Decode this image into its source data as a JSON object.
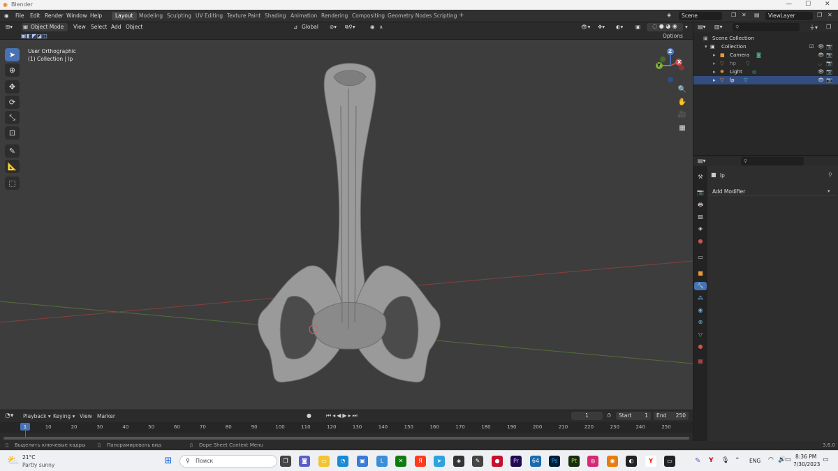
{
  "window": {
    "title": "Blender",
    "minimize": "—",
    "maximize": "☐",
    "close": "✕"
  },
  "menu": [
    "File",
    "Edit",
    "Render",
    "Window",
    "Help"
  ],
  "workspaces": [
    "Layout",
    "Modeling",
    "Sculpting",
    "UV Editing",
    "Texture Paint",
    "Shading",
    "Animation",
    "Rendering",
    "Compositing",
    "Geometry Nodes",
    "Scripting"
  ],
  "active_workspace": "Layout",
  "add_workspace": "+",
  "scene": {
    "name": "Scene",
    "view_layer": "ViewLayer"
  },
  "viewport": {
    "mode": "Object Mode",
    "menus": [
      "View",
      "Select",
      "Add",
      "Object"
    ],
    "transform_orientation": "Global",
    "options": "Options",
    "view_name": "User Orthographic",
    "collection_info": "(1) Collection | lp",
    "gizmo": {
      "x": "X",
      "y": "Y",
      "z": "Z"
    }
  },
  "outliner": {
    "search_placeholder": "",
    "items": [
      {
        "label": "Scene Collection"
      },
      {
        "label": "Collection"
      },
      {
        "label": "Camera"
      },
      {
        "label": "hp"
      },
      {
        "label": "Light"
      },
      {
        "label": "lp"
      }
    ]
  },
  "properties": {
    "object_name": "lp",
    "add_modifier": "Add Modifier"
  },
  "timeline": {
    "menus": [
      "Playback",
      "Keying",
      "View",
      "Marker"
    ],
    "current_frame": "1",
    "start_label": "Start",
    "start": "1",
    "end_label": "End",
    "end": "250",
    "ticks": [
      "1",
      "10",
      "20",
      "30",
      "40",
      "50",
      "60",
      "70",
      "80",
      "90",
      "100",
      "110",
      "120",
      "130",
      "140",
      "150",
      "160",
      "170",
      "180",
      "190",
      "200",
      "210",
      "220",
      "230",
      "240",
      "250"
    ]
  },
  "status": {
    "left": "Выделить ключевые кадры",
    "middle": "Панорамировать вид",
    "right": "Dope Sheet Context Menu",
    "version": "3.6.0"
  },
  "taskbar": {
    "weather_temp": "21°C",
    "weather_desc": "Partly sunny",
    "search": "Поиск",
    "lang": "ENG",
    "time": "8:36 PM",
    "date": "7/30/2023"
  },
  "colors": {
    "accent": "#4772b3",
    "selection": "#334d80",
    "viewport_bg": "#3d3d3d"
  }
}
